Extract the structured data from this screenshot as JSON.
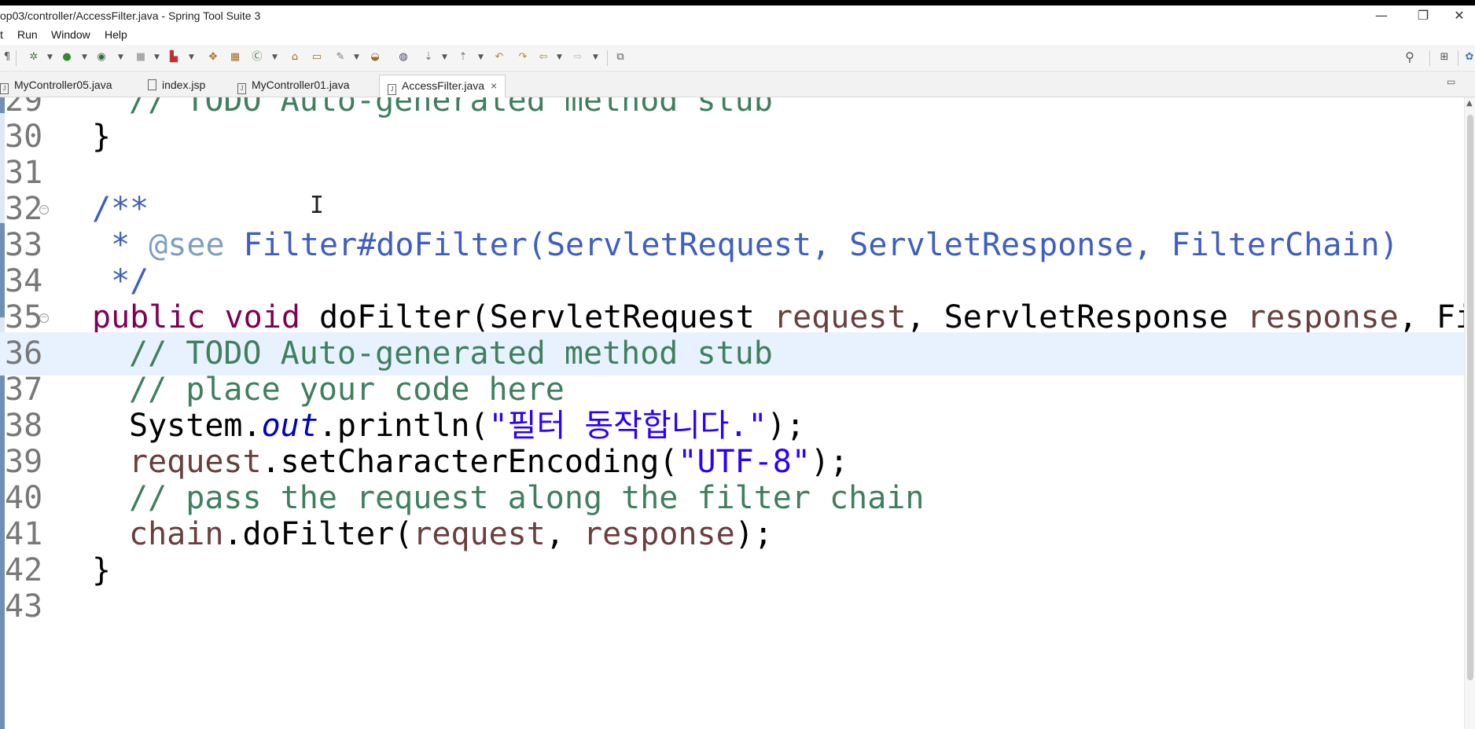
{
  "window": {
    "title": "op03/controller/AccessFilter.java - Spring Tool Suite 3",
    "minimize": "—",
    "restore": "❐",
    "close": "✕"
  },
  "menu": [
    "t",
    "Run",
    "Window",
    "Help"
  ],
  "tabs": [
    {
      "label": "MyController05.java",
      "active": false
    },
    {
      "label": "index.jsp",
      "active": false
    },
    {
      "label": "MyController01.java",
      "active": false
    },
    {
      "label": "AccessFilter.java",
      "active": true,
      "close": "×"
    }
  ],
  "editor": {
    "ibeam": "I",
    "lines": [
      {
        "num": "29",
        "parts": [
          [
            "c-comment",
            "// TODO Auto-generated method stub"
          ]
        ],
        "indent": 2
      },
      {
        "num": "30",
        "parts": [
          [
            "",
            "}"
          ]
        ],
        "indent": 1
      },
      {
        "num": "31",
        "parts": [],
        "indent": 0
      },
      {
        "num": "32",
        "parts": [
          [
            "c-doc",
            "/**"
          ]
        ],
        "indent": 1,
        "fold": true
      },
      {
        "num": "33",
        "parts": [
          [
            "c-doc",
            " * "
          ],
          [
            "c-tag",
            "@see"
          ],
          [
            "c-doc",
            " Filter#doFilter(ServletRequest, ServletResponse, FilterChain)"
          ]
        ],
        "indent": 1
      },
      {
        "num": "34",
        "parts": [
          [
            "c-doc",
            " */"
          ]
        ],
        "indent": 1
      },
      {
        "num": "35",
        "parts": [
          [
            "c-kw",
            "public"
          ],
          [
            "",
            " "
          ],
          [
            "c-kw",
            "void"
          ],
          [
            "",
            " doFilter(ServletRequest "
          ],
          [
            "c-var",
            "request"
          ],
          [
            "",
            ", ServletResponse "
          ],
          [
            "c-var",
            "response"
          ],
          [
            "",
            ", Fil"
          ]
        ],
        "indent": 1,
        "fold": true
      },
      {
        "num": "36",
        "parts": [
          [
            "c-comment",
            "// TODO Auto-generated method stub"
          ]
        ],
        "indent": 2,
        "highlight": true
      },
      {
        "num": "37",
        "parts": [
          [
            "c-comment",
            "// place your code here"
          ]
        ],
        "indent": 2
      },
      {
        "num": "38",
        "parts": [
          [
            "",
            "System."
          ],
          [
            "c-static",
            "out"
          ],
          [
            "",
            ".println("
          ],
          [
            "c-str",
            "\"필터 동작합니다.\""
          ],
          [
            "",
            ");"
          ]
        ],
        "indent": 2
      },
      {
        "num": "39",
        "parts": [
          [
            "c-var",
            "request"
          ],
          [
            "",
            ".setCharacterEncoding("
          ],
          [
            "c-str",
            "\"UTF-8\""
          ],
          [
            "",
            ");"
          ]
        ],
        "indent": 2
      },
      {
        "num": "40",
        "parts": [
          [
            "c-comment",
            "// pass the request along the filter chain"
          ]
        ],
        "indent": 2
      },
      {
        "num": "41",
        "parts": [
          [
            "c-var",
            "chain"
          ],
          [
            "",
            ".doFilter("
          ],
          [
            "c-var",
            "request"
          ],
          [
            "",
            ", "
          ],
          [
            "c-var",
            "response"
          ],
          [
            "",
            ");"
          ]
        ],
        "indent": 2
      },
      {
        "num": "42",
        "parts": [
          [
            "",
            "}"
          ]
        ],
        "indent": 1
      },
      {
        "num": "43",
        "parts": [],
        "indent": 0
      }
    ]
  }
}
